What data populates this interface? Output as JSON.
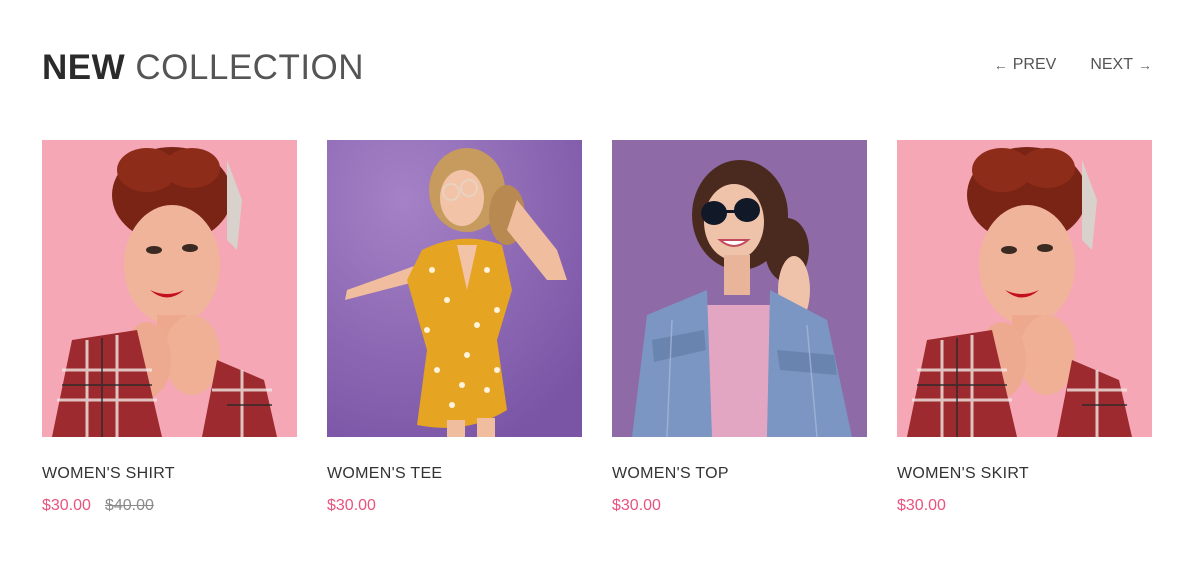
{
  "header": {
    "title_bold": "NEW",
    "title_light": "COLLECTION",
    "prev_label": "PREV",
    "next_label": "NEXT",
    "prev_arrow": "←",
    "next_arrow": "→"
  },
  "products": [
    {
      "name": "WOMEN'S SHIRT",
      "price": "$30.00",
      "old_price": "$40.00",
      "image": "woman-plaid-shirt-pink-bg"
    },
    {
      "name": "WOMEN'S TEE",
      "price": "$30.00",
      "old_price": "",
      "image": "woman-yellow-dress-purple-bg"
    },
    {
      "name": "WOMEN'S TOP",
      "price": "$30.00",
      "old_price": "",
      "image": "woman-denim-jacket-purple-bg"
    },
    {
      "name": "WOMEN'S SKIRT",
      "price": "$30.00",
      "old_price": "",
      "image": "woman-plaid-shirt-pink-bg"
    }
  ],
  "colors": {
    "accent_price": "#e9537e",
    "pink_bg": "#f6aab8",
    "purple_bg": "#8c67b0"
  }
}
